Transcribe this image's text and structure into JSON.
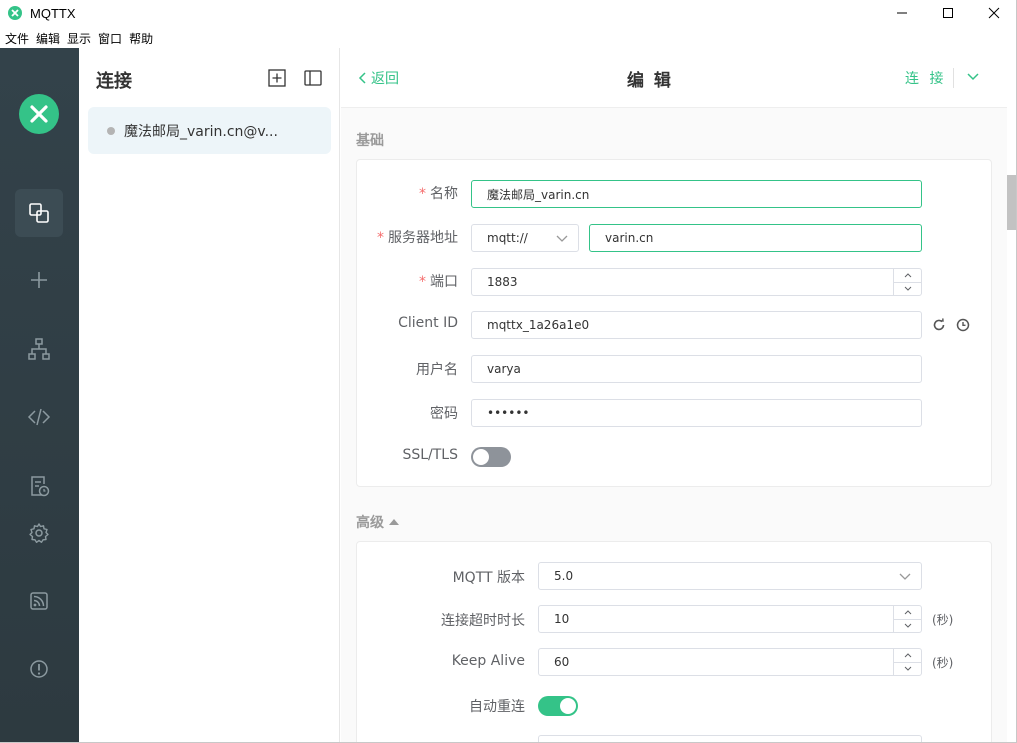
{
  "window": {
    "title": "MQTTX"
  },
  "menu": [
    "文件",
    "编辑",
    "显示",
    "窗口",
    "帮助"
  ],
  "connections_panel": {
    "title": "连接",
    "items": [
      {
        "name": "魔法邮局_varin.cn@v..."
      }
    ]
  },
  "header": {
    "back_label": "返回",
    "title": "编 辑",
    "connect_label": "连 接"
  },
  "basic": {
    "section_title": "基础",
    "name_label": "名称",
    "name_value": "魔法邮局_varin.cn",
    "host_label": "服务器地址",
    "protocol_value": "mqtt://",
    "host_value": "varin.cn",
    "port_label": "端口",
    "port_value": "1883",
    "client_id_label": "Client ID",
    "client_id_value": "mqttx_1a26a1e0",
    "username_label": "用户名",
    "username_value": "varya",
    "password_label": "密码",
    "password_value": "••••••",
    "ssl_label": "SSL/TLS",
    "ssl_enabled": false
  },
  "advanced": {
    "section_title": "高级",
    "mqtt_version_label": "MQTT 版本",
    "mqtt_version_value": "5.0",
    "timeout_label": "连接超时时长",
    "timeout_value": "10",
    "timeout_unit": "(秒)",
    "keepalive_label": "Keep Alive",
    "keepalive_value": "60",
    "keepalive_unit": "(秒)",
    "reconnect_label": "自动重连",
    "reconnect_enabled": true
  },
  "colors": {
    "accent": "#34c388",
    "sidebar": "#2f3d44",
    "required": "#f56c6c"
  }
}
